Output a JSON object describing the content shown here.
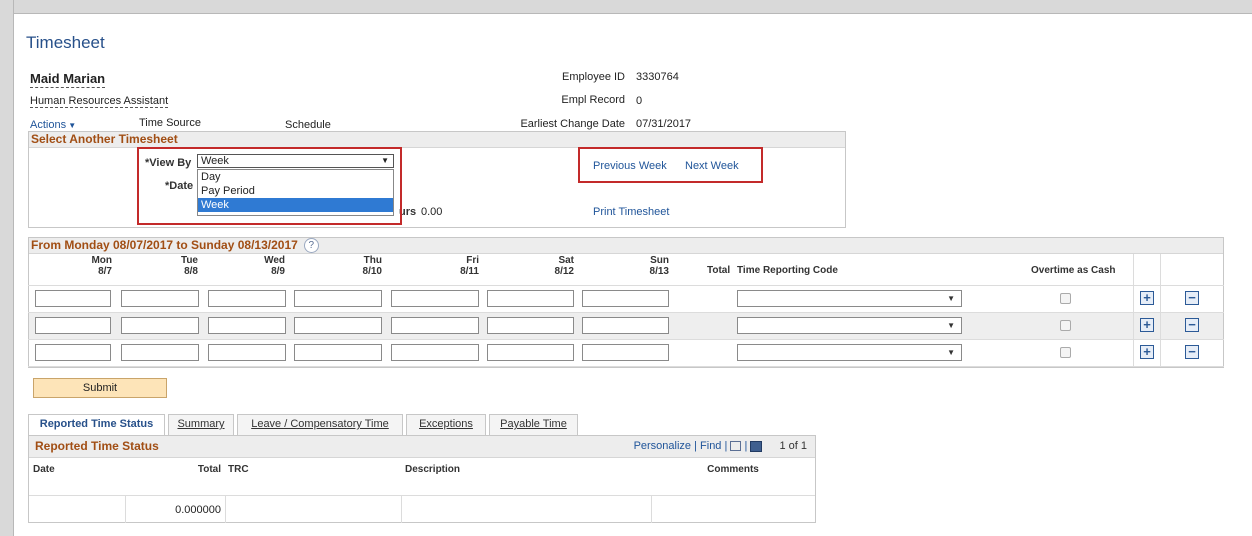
{
  "page": {
    "title": "Timesheet",
    "employee_name": "Maid Marian",
    "job_title": "Human Resources Assistant",
    "actions_label": "Actions",
    "time_source_label": "Time Source",
    "schedule_label": "Schedule"
  },
  "employee_info": {
    "employee_id_label": "Employee ID",
    "employee_id": "3330764",
    "empl_record_label": "Empl Record",
    "empl_record": "0",
    "earliest_change_label": "Earliest Change Date",
    "earliest_change_date": "07/31/2017"
  },
  "select_timesheet": {
    "header": "Select Another Timesheet",
    "view_by_label": "*View By",
    "view_by_value": "Week",
    "date_label": "*Date",
    "options": [
      "Day",
      "Pay Period",
      "Week"
    ],
    "hours_label_fragment": "urs",
    "hours_value": "0.00",
    "previous_week": "Previous Week",
    "next_week": "Next Week",
    "print_timesheet": "Print Timesheet"
  },
  "grid": {
    "header": "From Monday 08/07/2017 to Sunday 08/13/2017",
    "days": [
      {
        "day": "Mon",
        "date": "8/7"
      },
      {
        "day": "Tue",
        "date": "8/8"
      },
      {
        "day": "Wed",
        "date": "8/9"
      },
      {
        "day": "Thu",
        "date": "8/10"
      },
      {
        "day": "Fri",
        "date": "8/11"
      },
      {
        "day": "Sat",
        "date": "8/12"
      },
      {
        "day": "Sun",
        "date": "8/13"
      }
    ],
    "total_label": "Total",
    "trc_label": "Time Reporting Code",
    "overtime_label": "Overtime as Cash",
    "rows": 3
  },
  "submit_label": "Submit",
  "tabs": [
    {
      "label": "Reported Time Status"
    },
    {
      "label": "Summary"
    },
    {
      "label": "Leave / Compensatory Time"
    },
    {
      "label": "Exceptions"
    },
    {
      "label": "Payable Time"
    }
  ],
  "reported_status": {
    "title": "Reported Time Status",
    "personalize": "Personalize",
    "find": "Find",
    "pagination": "1 of 1",
    "columns": {
      "date": "Date",
      "total": "Total",
      "trc": "TRC",
      "description": "Description",
      "comments": "Comments"
    },
    "rows": [
      {
        "date": "",
        "total": "0.000000",
        "trc": "",
        "description": "",
        "comments": ""
      }
    ]
  },
  "colors": {
    "accent_blue": "#27508a",
    "section_header": "#a14e14",
    "highlight_red": "#c32a2a",
    "selected_option": "#2f7ad3"
  }
}
